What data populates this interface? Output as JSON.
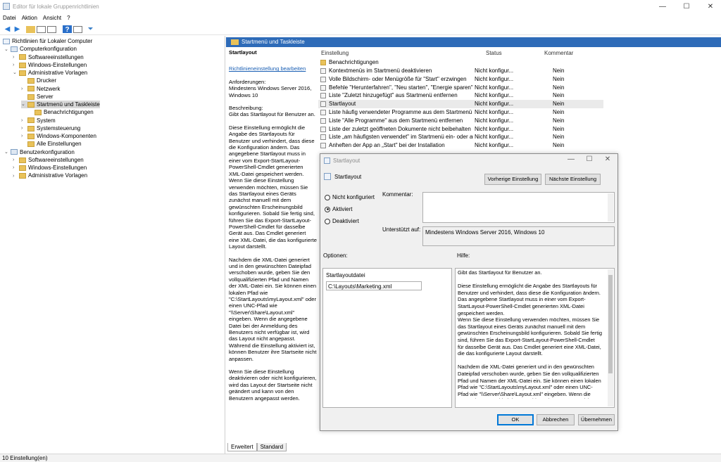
{
  "window": {
    "title": "Editor für lokale Gruppenrichtlinien",
    "min": "—",
    "max": "☐",
    "close": "✕"
  },
  "menu": [
    "Datei",
    "Aktion",
    "Ansicht",
    "?"
  ],
  "toolbar_icons": [
    "back-icon",
    "forward-icon",
    "folder-up-icon",
    "show-hide-tree-icon",
    "export-list-icon",
    "help-icon",
    "properties-icon",
    "filter-icon"
  ],
  "tree": {
    "root": "Richtlinien für Lokaler Computer",
    "items": [
      {
        "label": "Computerkonfiguration",
        "level": 1,
        "exp": "v",
        "icon": "computer"
      },
      {
        "label": "Softwareeinstellungen",
        "level": 2,
        "exp": ">"
      },
      {
        "label": "Windows-Einstellungen",
        "level": 2,
        "exp": ">"
      },
      {
        "label": "Administrative Vorlagen",
        "level": 2,
        "exp": "v"
      },
      {
        "label": "Drucker",
        "level": 3,
        "exp": ""
      },
      {
        "label": "Netzwerk",
        "level": 3,
        "exp": ">"
      },
      {
        "label": "Server",
        "level": 3,
        "exp": ""
      },
      {
        "label": "Startmenü und Taskleiste",
        "level": 3,
        "exp": "v",
        "selected": true
      },
      {
        "label": "Benachrichtigungen",
        "level": 4,
        "exp": ""
      },
      {
        "label": "System",
        "level": 3,
        "exp": ">"
      },
      {
        "label": "Systemsteuerung",
        "level": 3,
        "exp": ">"
      },
      {
        "label": "Windows-Komponenten",
        "level": 3,
        "exp": ">"
      },
      {
        "label": "Alle Einstellungen",
        "level": 3,
        "exp": ""
      },
      {
        "label": "Benutzerkonfiguration",
        "level": 1,
        "exp": "v",
        "icon": "user"
      },
      {
        "label": "Softwareeinstellungen",
        "level": 2,
        "exp": ">"
      },
      {
        "label": "Windows-Einstellungen",
        "level": 2,
        "exp": ">"
      },
      {
        "label": "Administrative Vorlagen",
        "level": 2,
        "exp": ">"
      }
    ]
  },
  "header": {
    "title": "Startmenü und Taskleiste"
  },
  "desc": {
    "title": "Startlayout",
    "link": "Richtlinieneinstellung bearbeiten",
    "req_label": "Anforderungen:",
    "req_value": "Mindestens Windows Server 2016, Windows 10",
    "desc_label": "Beschreibung:",
    "desc_value": "Gibt das Startlayout für Benutzer an.",
    "p1": "Diese Einstellung ermöglicht die Angabe des Startlayouts für Benutzer und verhindert, dass diese die Konfiguration ändern. Das angegebene Startlayout muss in einer vom Export-StartLayout-PowerShell-Cmdlet generierten XML-Datei gespeichert werden.",
    "p2": "Wenn Sie diese Einstellung verwenden möchten, müssen Sie das Startlayout eines Geräts zunächst manuell mit dem gewünschten Erscheinungsbild konfigurieren. Sobald Sie fertig sind, führen Sie das Export-StartLayout-PowerShell-Cmdlet für dasselbe Gerät aus. Das Cmdlet generiert eine XML-Datei, die das konfigurierte Layout darstellt.",
    "p3": "Nachdem die XML-Datei generiert und in den gewünschten Dateipfad verschoben wurde, geben Sie den vollqualifizierten Pfad und Namen der XML-Datei ein. Sie können einen lokalen Pfad wie \"C:\\StartLayouts\\myLayout.xml\" oder einen UNC-Pfad wie \"\\\\Server\\Share\\Layout.xml\" eingeben. Wenn die angegebene Datei bei der Anmeldung des Benutzers nicht verfügbar ist, wird das Layout nicht angepasst. Während die Einstellung aktiviert ist, können Benutzer ihre Startseite nicht anpassen.",
    "p4": "Wenn Sie diese Einstellung deaktivieren oder nicht konfigurieren, wird das Layout der Startseite nicht geändert und kann von den Benutzern angepasst werden."
  },
  "list": {
    "columns": {
      "name": "Einstellung",
      "status": "Status",
      "comment": "Kommentar"
    },
    "folder": "Benachrichtigungen",
    "rows": [
      {
        "name": "Kontextmenüs im Startmenü deaktivieren",
        "status": "Nicht konfigur...",
        "comment": "Nein"
      },
      {
        "name": "Volle Bildschirm- oder Menügröße für \"Start\" erzwingen",
        "status": "Nicht konfigur...",
        "comment": "Nein"
      },
      {
        "name": "Befehle \"Herunterfahren\", \"Neu starten\", \"Energie sparen\" u...",
        "status": "Nicht konfigur...",
        "comment": "Nein"
      },
      {
        "name": "Liste \"Zuletzt hinzugefügt\" aus Startmenü entfernen",
        "status": "Nicht konfigur...",
        "comment": "Nein"
      },
      {
        "name": "Startlayout",
        "status": "Nicht konfigur...",
        "comment": "Nein",
        "selected": true
      },
      {
        "name": "Liste häufig verwendeter Programme aus dem Startmenü en...",
        "status": "Nicht konfigur...",
        "comment": "Nein"
      },
      {
        "name": "Liste \"Alle Programme\" aus dem Startmenü entfernen",
        "status": "Nicht konfigur...",
        "comment": "Nein"
      },
      {
        "name": "Liste der zuletzt geöffneten Dokumente nicht beibehalten",
        "status": "Nicht konfigur...",
        "comment": "Nein"
      },
      {
        "name": "Liste „am häufigsten verwendet\" im Startmenü ein- oder au...",
        "status": "Nicht konfigur...",
        "comment": "Nein"
      },
      {
        "name": "Anheften der App an „Start\" bei der Installation",
        "status": "Nicht konfigur...",
        "comment": "Nein"
      }
    ]
  },
  "tabs": [
    "Erweitert",
    "Standard"
  ],
  "status": "10 Einstellung(en)",
  "dialog": {
    "title": "Startlayout",
    "heading": "Startlayout",
    "prev": "Vorherige Einstellung",
    "next": "Nächste Einstellung",
    "radio_nc": "Nicht konfiguriert",
    "radio_on": "Aktiviert",
    "radio_off": "Deaktiviert",
    "comment_label": "Kommentar:",
    "supported_label": "Unterstützt auf:",
    "supported_value": "Mindestens Windows Server 2016, Windows 10",
    "options_label": "Optionen:",
    "help_label": "Hilfe:",
    "option_field_label": "Startlayoutdatei",
    "option_field_value": "C:\\Layouts\\Marketing.xml",
    "help": [
      "Gibt das Startlayout für Benutzer an.",
      "Diese Einstellung ermöglicht die Angabe des Startlayouts für Benutzer und verhindert, dass diese die Konfiguration ändern. Das angegebene Startlayout muss in einer vom Export-StartLayout-PowerShell-Cmdlet generierten XML-Datei gespeichert werden.\nWenn Sie diese Einstellung verwenden möchten, müssen Sie das Startlayout eines Geräts zunächst manuell mit dem gewünschten Erscheinungsbild konfigurieren. Sobald Sie fertig sind, führen Sie das Export-StartLayout-PowerShell-Cmdlet für dasselbe Gerät aus. Das Cmdlet generiert eine XML-Datei, die das konfigurierte Layout darstellt.",
      "Nachdem die XML-Datei generiert und in den gewünschten Dateipfad verschoben wurde, geben Sie den vollqualifizierten Pfad und Namen der XML-Datei ein. Sie können einen lokalen Pfad wie \"C:\\StartLayouts\\myLayout.xml\" oder einen UNC-Pfad wie \"\\\\Server\\Share\\Layout.xml\" eingeben. Wenn die angegebene Datei bei der Anmeldung des Benutzers nicht verfügbar ist, wird das Layout nicht angepasst. Während die"
    ],
    "ok": "OK",
    "cancel": "Abbrechen",
    "apply": "Übernehmen"
  }
}
